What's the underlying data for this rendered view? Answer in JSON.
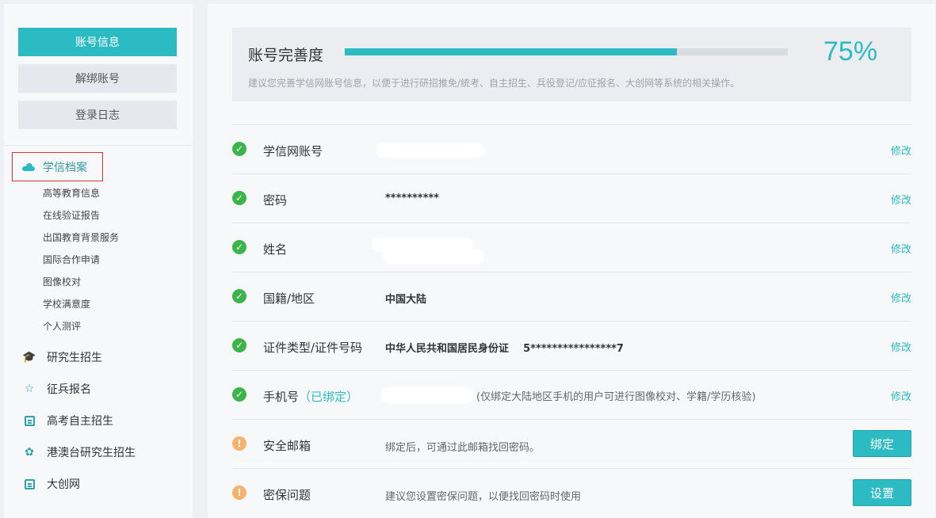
{
  "sidebar": {
    "account_buttons": [
      {
        "label": "账号信息",
        "active": true
      },
      {
        "label": "解绑账号",
        "active": false
      },
      {
        "label": "登录日志",
        "active": false
      }
    ],
    "archive": {
      "label": "学信档案",
      "icon": "cloud-icon"
    },
    "sub_items": [
      "高等教育信息",
      "在线验证报告",
      "出国教育背景服务",
      "国际合作申请",
      "图像校对",
      "学校满意度",
      "个人测评"
    ],
    "nav_items": [
      {
        "label": "研究生招生",
        "icon": "graduation-cap-icon"
      },
      {
        "label": "征兵报名",
        "icon": "star-icon"
      },
      {
        "label": "高考自主招生",
        "icon": "notebook-icon"
      },
      {
        "label": "港澳台研究生招生",
        "icon": "flower-icon"
      },
      {
        "label": "大创网",
        "icon": "board-icon"
      }
    ]
  },
  "completeness": {
    "title": "账号完善度",
    "percent_text": "75%",
    "percent": 75,
    "hint": "建议您完善学信网账号信息，以便于进行研招推免/统考、自主招生、兵役登记/应征报名、大创网等系统的相关操作。",
    "accent": "#2dbbc3"
  },
  "rows": [
    {
      "label": "学信网账号",
      "value": "",
      "action": "修改",
      "status": "ok"
    },
    {
      "label": "密码",
      "value": "**********",
      "action": "修改",
      "status": "ok"
    },
    {
      "label": "姓名",
      "value": "",
      "action": "修改",
      "status": "ok"
    },
    {
      "label": "国籍/地区",
      "value": "中国大陆",
      "action": "修改",
      "status": "ok"
    },
    {
      "label": "证件类型/证件号码",
      "value": "中华人民共和国居民身份证    5****************7",
      "action": "修改",
      "status": "ok"
    },
    {
      "label": "手机号",
      "bound_tag": "（已绑定）",
      "value": "",
      "note": "(仅绑定大陆地区手机的用户可进行图像校对、学籍/学历核验)",
      "action": "修改",
      "status": "ok"
    },
    {
      "label": "安全邮箱",
      "note": "绑定后，可通过此邮箱找回密码。",
      "action": "绑定",
      "status": "warn"
    },
    {
      "label": "密保问题",
      "note": "建议您设置密保问题，以便找回密码时使用",
      "action": "设置",
      "status": "warn"
    }
  ],
  "status_glyphs": {
    "ok": "✓",
    "warn": "!"
  }
}
